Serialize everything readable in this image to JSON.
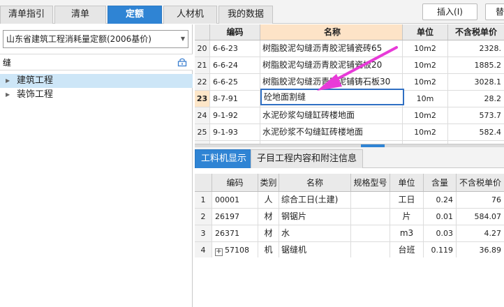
{
  "top_tabs": [
    {
      "label": "清单指引",
      "active": false
    },
    {
      "label": "清单",
      "active": false
    },
    {
      "label": "定额",
      "active": true
    },
    {
      "label": "人材机",
      "active": false
    },
    {
      "label": "我的数据",
      "active": false
    }
  ],
  "toolbar": {
    "insert_label": "插入(I)",
    "replace_label_partial": "替"
  },
  "left_panel": {
    "quota_library": "山东省建筑工程消耗量定额(2006基价)",
    "search_value": "缝",
    "tree": [
      {
        "label": "建筑工程",
        "selected": true
      },
      {
        "label": "装饰工程",
        "selected": false
      }
    ]
  },
  "quota_table": {
    "columns": {
      "code": "编码",
      "name": "名称",
      "unit": "单位",
      "price": "不含税单价"
    },
    "rows": [
      {
        "row_num": "20",
        "code": "6-6-23",
        "name": "树脂胶泥勾缝沥青胶泥铺瓷砖65",
        "unit": "10m2",
        "price": "2328."
      },
      {
        "row_num": "21",
        "code": "6-6-24",
        "name": "树脂胶泥勾缝沥青胶泥铺瓷板20",
        "unit": "10m2",
        "price": "1885.2"
      },
      {
        "row_num": "22",
        "code": "6-6-25",
        "name": "树脂胶泥勾缝沥青胶泥铺铸石板30",
        "unit": "10m2",
        "price": "3028.1"
      },
      {
        "row_num": "23",
        "code": "8-7-91",
        "name": "砼地面割缝",
        "unit": "10m",
        "price": "28.2",
        "active": true
      },
      {
        "row_num": "24",
        "code": "9-1-92",
        "name": "水泥砂浆勾缝缸砖楼地面",
        "unit": "10m2",
        "price": "573.7"
      },
      {
        "row_num": "25",
        "code": "9-1-93",
        "name": "水泥砂浆不勾缝缸砖楼地面",
        "unit": "10m2",
        "price": "582.4"
      }
    ]
  },
  "sub_tabs": [
    {
      "label": "工料机显示",
      "active": true
    },
    {
      "label": "子目工程内容和附注信息",
      "active": false
    }
  ],
  "resource_table": {
    "columns": {
      "code": "编码",
      "category": "类别",
      "name": "名称",
      "spec": "规格型号",
      "unit": "单位",
      "quantity": "含量",
      "price": "不含税单价"
    },
    "rows": [
      {
        "row_num": "1",
        "code": "00001",
        "category": "人",
        "name": "综合工日(土建)",
        "spec": "",
        "unit": "工日",
        "quantity": "0.24",
        "price": "76"
      },
      {
        "row_num": "2",
        "code": "26197",
        "category": "材",
        "name": "钢锯片",
        "spec": "",
        "unit": "片",
        "quantity": "0.01",
        "price": "584.07"
      },
      {
        "row_num": "3",
        "code": "26371",
        "category": "材",
        "name": "水",
        "spec": "",
        "unit": "m3",
        "quantity": "0.03",
        "price": "4.27"
      },
      {
        "row_num": "4",
        "code": "57108",
        "category": "机",
        "name": "锯缝机",
        "spec": "",
        "unit": "台班",
        "quantity": "0.119",
        "price": "36.89",
        "expandable": true
      }
    ]
  },
  "colors": {
    "tab_active": "#2f84d4",
    "selection": "#cde6f7",
    "name_header": "#fde3c7",
    "annotation_arrow": "#e83ad8"
  }
}
